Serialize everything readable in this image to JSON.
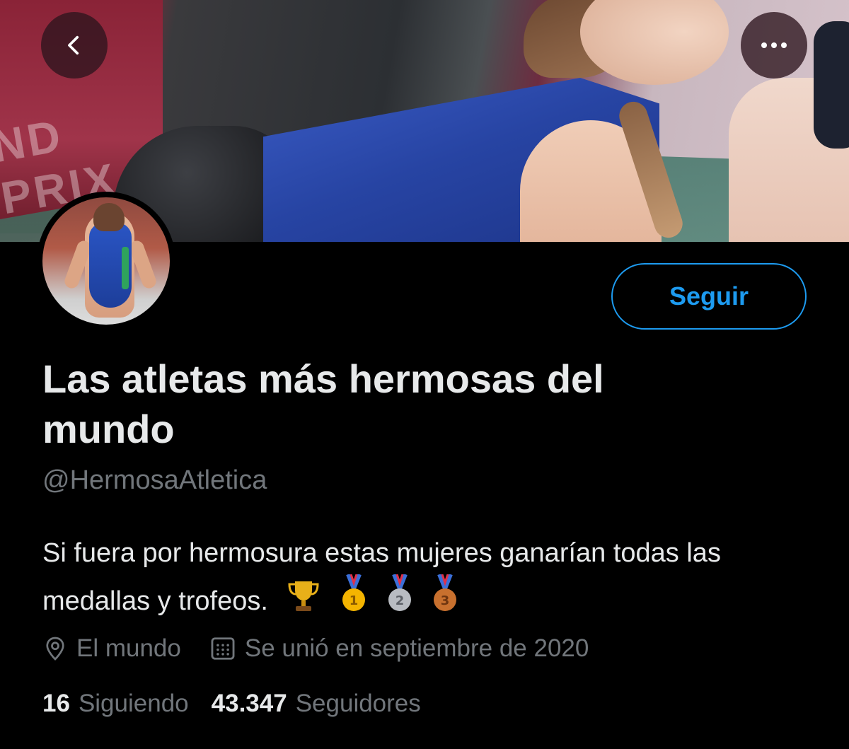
{
  "header": {
    "back_icon": "chevron-left-icon",
    "more_icon": "ellipsis-icon",
    "overlay_color": "#2d141e"
  },
  "profile": {
    "name": "Las atletas más hermosas del mundo",
    "handle": "@HermosaAtletica",
    "bio": "Si fuera por hermosura estas mujeres ganarían todas las medallas y trofeos.",
    "bio_emojis": [
      "trophy-icon",
      "gold-medal-icon",
      "silver-medal-icon",
      "bronze-medal-icon"
    ],
    "location": "El mundo",
    "joined": "Se unió en septiembre de 2020"
  },
  "actions": {
    "follow_label": "Seguir",
    "accent_color": "#1d9bf0"
  },
  "stats": {
    "following_count": "16",
    "following_label": "Siguiendo",
    "followers_count": "43.347",
    "followers_label": "Seguidores"
  },
  "colors": {
    "background": "#000000",
    "text_primary": "#e7e9ea",
    "text_secondary": "#71767b"
  }
}
